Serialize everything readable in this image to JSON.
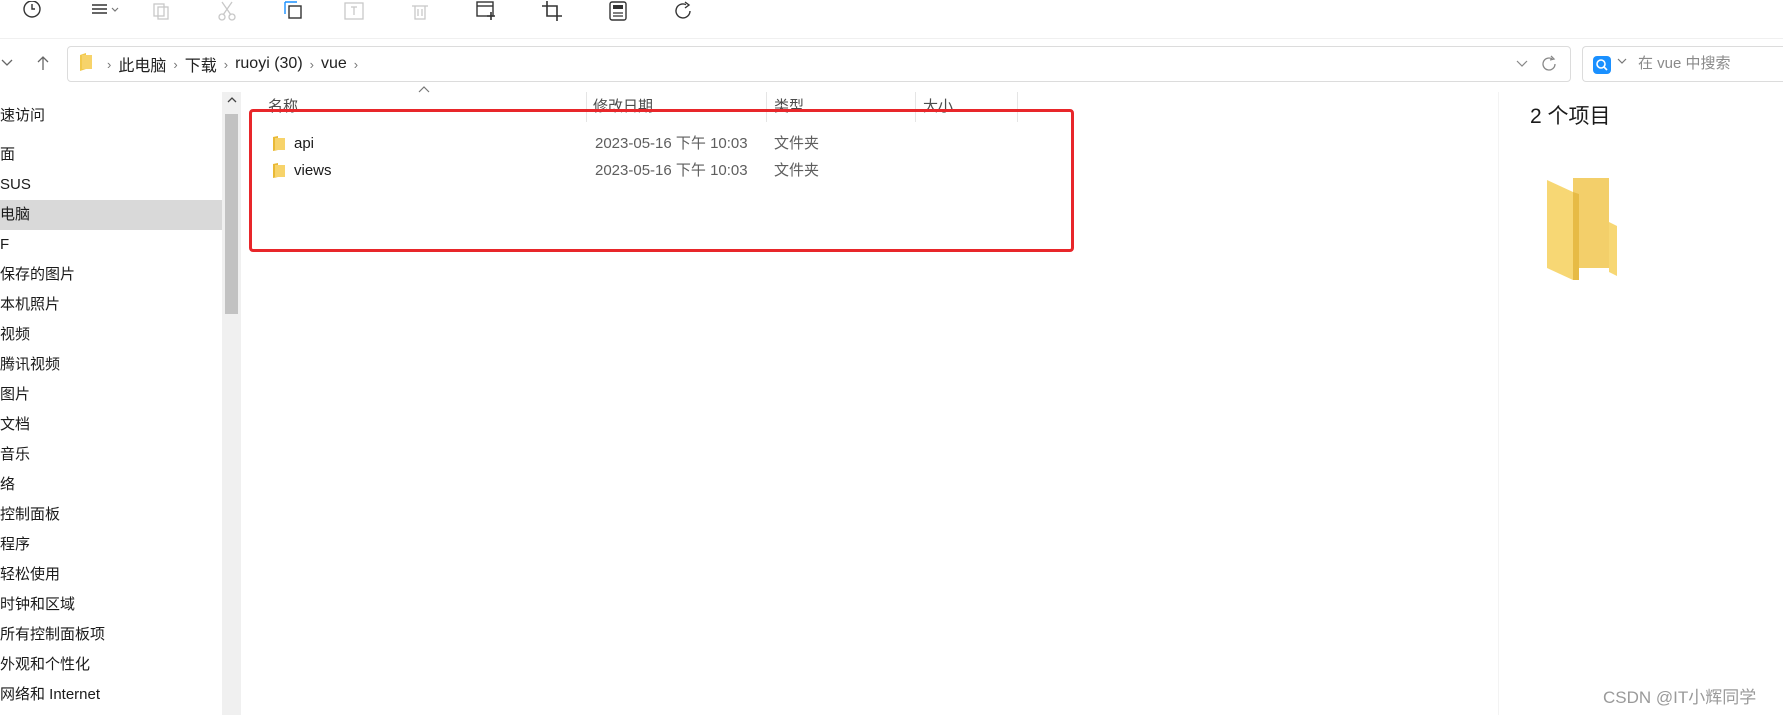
{
  "toolbar": {
    "icons": [
      "history-icon",
      "view-options-icon",
      "copy-icon",
      "cut-icon",
      "select-icon",
      "rename-icon",
      "delete-icon",
      "new-item-icon",
      "crop-icon",
      "calculator-icon",
      "refresh-icon"
    ]
  },
  "address_bar": {
    "crumbs": [
      "此电脑",
      "下载",
      "ruoyi (30)",
      "vue"
    ]
  },
  "search": {
    "placeholder": "在 vue 中搜索"
  },
  "sidebar": {
    "items": [
      {
        "label": "速访问"
      },
      {
        "label": "面"
      },
      {
        "label": "SUS"
      },
      {
        "label": "电脑",
        "selected": true
      },
      {
        "label": "F"
      },
      {
        "label": "保存的图片"
      },
      {
        "label": "本机照片"
      },
      {
        "label": "视频"
      },
      {
        "label": "腾讯视频"
      },
      {
        "label": "图片"
      },
      {
        "label": "文档"
      },
      {
        "label": "音乐"
      },
      {
        "label": "络"
      },
      {
        "label": "控制面板"
      },
      {
        "label": "程序"
      },
      {
        "label": "轻松使用"
      },
      {
        "label": "时钟和区域"
      },
      {
        "label": "所有控制面板项"
      },
      {
        "label": "外观和个性化"
      },
      {
        "label": "网络和 Internet"
      }
    ]
  },
  "columns": {
    "name": "名称",
    "modified": "修改日期",
    "type": "类型",
    "size": "大小"
  },
  "files": [
    {
      "name": "api",
      "modified": "2023-05-16 下午 10:03",
      "type": "文件夹"
    },
    {
      "name": "views",
      "modified": "2023-05-16 下午 10:03",
      "type": "文件夹"
    }
  ],
  "details": {
    "count": "2 个项目"
  },
  "watermark": "CSDN @IT小辉同学",
  "colors": {
    "highlight": "#e8262a",
    "folder": "#f7d36a",
    "accent": "#1a90ff",
    "selected_bg": "#d9d9d9"
  }
}
